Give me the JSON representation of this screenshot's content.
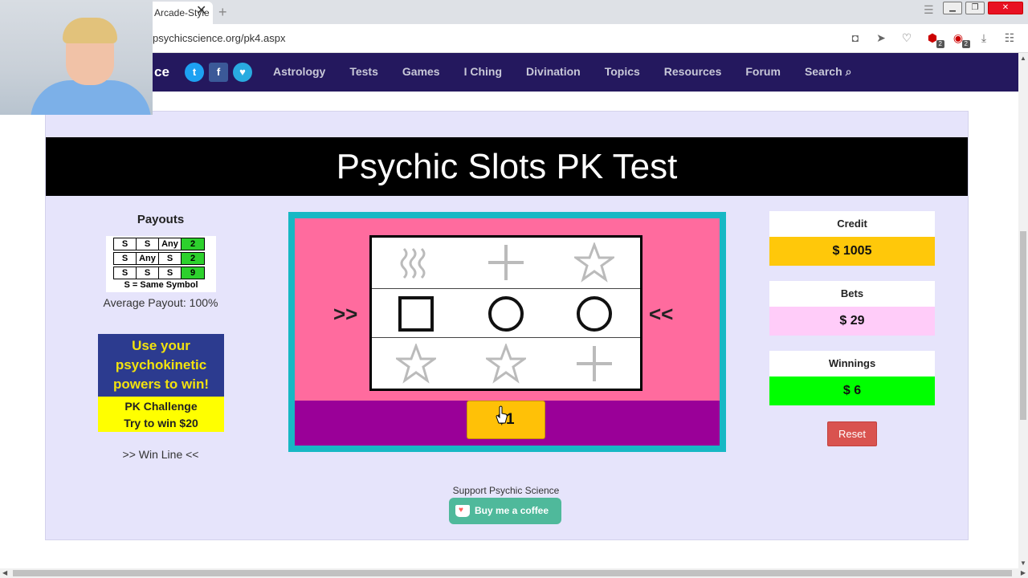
{
  "browser": {
    "tab_title": "Arcade-Style",
    "tab_close": "✕",
    "new_tab": "+",
    "url": "psychicscience.org/pk4.aspx"
  },
  "site": {
    "brand": "ce",
    "nav": [
      "Astrology",
      "Tests",
      "Games",
      "I Ching",
      "Divination",
      "Topics",
      "Resources",
      "Forum",
      "Search"
    ]
  },
  "page": {
    "title": "Psychic Slots PK Test"
  },
  "payouts": {
    "title": "Payouts",
    "rows": [
      [
        "S",
        "S",
        "Any",
        "2"
      ],
      [
        "S",
        "Any",
        "S",
        "2"
      ],
      [
        "S",
        "S",
        "S",
        "9"
      ]
    ],
    "note": "S = Same Symbol",
    "average": "Average Payout: 100%"
  },
  "ad": {
    "line1": "Use your",
    "line2": "psychokinetic",
    "line3": "powers to win!",
    "line4": "PK Challenge",
    "line5": "Try to win $20"
  },
  "winline_label": ">> Win Line <<",
  "machine": {
    "arrow_left": ">>",
    "arrow_right": "<<",
    "reels": [
      [
        "waves",
        "plus",
        "star"
      ],
      [
        "square",
        "circle",
        "circle"
      ],
      [
        "star",
        "star",
        "plus"
      ]
    ],
    "spin_label": "$1"
  },
  "stats": {
    "credit_label": "Credit",
    "credit_value": "$ 1005",
    "bets_label": "Bets",
    "bets_value": "$ 29",
    "winnings_label": "Winnings",
    "winnings_value": "$ 6"
  },
  "reset_label": "Reset",
  "support": {
    "label": "Support Psychic Science",
    "button": "Buy me a coffee"
  },
  "colors": {
    "nav_bg": "#24185e",
    "credit": "#ffc80a",
    "bets": "#ffccf9",
    "winnings": "#00ff00",
    "machine_frame": "#17b8c4",
    "machine_body": "#ff6b9e",
    "machine_base": "#9a0098"
  }
}
